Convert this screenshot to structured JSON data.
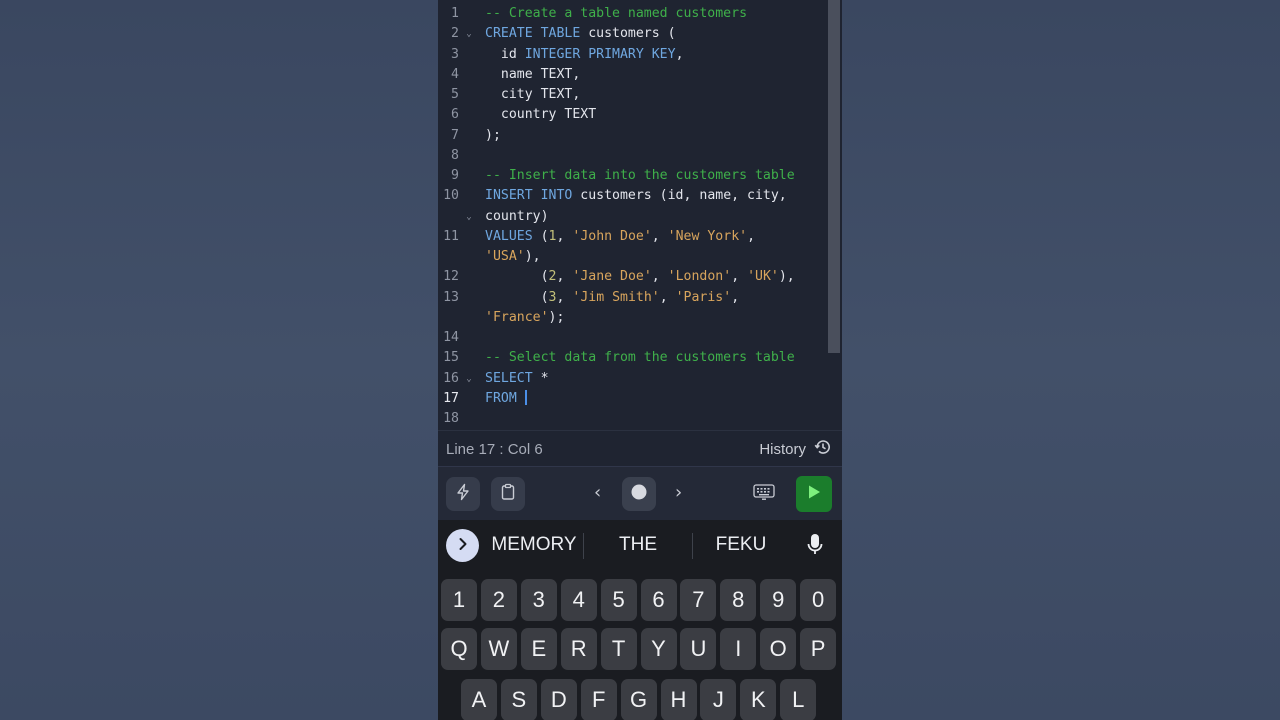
{
  "editor": {
    "lines": [
      {
        "num": "1",
        "fold": "",
        "tokens": [
          {
            "t": "-- Create a table named customers",
            "c": "cm"
          }
        ]
      },
      {
        "num": "2",
        "fold": "⌄",
        "tokens": [
          {
            "t": "CREATE TABLE",
            "c": "kw"
          },
          {
            "t": " customers (",
            "c": "tx"
          }
        ]
      },
      {
        "num": "3",
        "fold": "",
        "tokens": [
          {
            "t": "  id ",
            "c": "tx"
          },
          {
            "t": "INTEGER PRIMARY KEY",
            "c": "kw"
          },
          {
            "t": ",",
            "c": "tx"
          }
        ]
      },
      {
        "num": "4",
        "fold": "",
        "tokens": [
          {
            "t": "  name TEXT,",
            "c": "tx"
          }
        ]
      },
      {
        "num": "5",
        "fold": "",
        "tokens": [
          {
            "t": "  city TEXT,",
            "c": "tx"
          }
        ]
      },
      {
        "num": "6",
        "fold": "",
        "tokens": [
          {
            "t": "  country TEXT",
            "c": "tx"
          }
        ]
      },
      {
        "num": "7",
        "fold": "",
        "tokens": [
          {
            "t": ");",
            "c": "tx"
          }
        ]
      },
      {
        "num": "8",
        "fold": "",
        "tokens": []
      },
      {
        "num": "9",
        "fold": "",
        "tokens": [
          {
            "t": "-- Insert data into the customers table",
            "c": "cm"
          }
        ]
      },
      {
        "num": "10",
        "fold": "",
        "tokens": [
          {
            "t": "INSERT INTO",
            "c": "kw"
          },
          {
            "t": " customers (id, name, city,",
            "c": "tx"
          }
        ]
      },
      {
        "num": "",
        "fold": "⌄",
        "tokens": [
          {
            "t": "country)",
            "c": "tx"
          }
        ]
      },
      {
        "num": "11",
        "fold": "",
        "tokens": [
          {
            "t": "VALUES",
            "c": "kw"
          },
          {
            "t": " (",
            "c": "tx"
          },
          {
            "t": "1",
            "c": "nm"
          },
          {
            "t": ", ",
            "c": "tx"
          },
          {
            "t": "'John Doe'",
            "c": "st"
          },
          {
            "t": ", ",
            "c": "tx"
          },
          {
            "t": "'New York'",
            "c": "st"
          },
          {
            "t": ",",
            "c": "tx"
          }
        ]
      },
      {
        "num": "",
        "fold": "",
        "tokens": [
          {
            "t": "'USA'",
            "c": "st"
          },
          {
            "t": "),",
            "c": "tx"
          }
        ]
      },
      {
        "num": "12",
        "fold": "",
        "tokens": [
          {
            "t": "       (",
            "c": "tx"
          },
          {
            "t": "2",
            "c": "nm"
          },
          {
            "t": ", ",
            "c": "tx"
          },
          {
            "t": "'Jane Doe'",
            "c": "st"
          },
          {
            "t": ", ",
            "c": "tx"
          },
          {
            "t": "'London'",
            "c": "st"
          },
          {
            "t": ", ",
            "c": "tx"
          },
          {
            "t": "'UK'",
            "c": "st"
          },
          {
            "t": "),",
            "c": "tx"
          }
        ]
      },
      {
        "num": "13",
        "fold": "",
        "tokens": [
          {
            "t": "       (",
            "c": "tx"
          },
          {
            "t": "3",
            "c": "nm"
          },
          {
            "t": ", ",
            "c": "tx"
          },
          {
            "t": "'Jim Smith'",
            "c": "st"
          },
          {
            "t": ", ",
            "c": "tx"
          },
          {
            "t": "'Paris'",
            "c": "st"
          },
          {
            "t": ",",
            "c": "tx"
          }
        ]
      },
      {
        "num": "",
        "fold": "",
        "tokens": [
          {
            "t": "'France'",
            "c": "st"
          },
          {
            "t": ");",
            "c": "tx"
          }
        ]
      },
      {
        "num": "14",
        "fold": "",
        "tokens": []
      },
      {
        "num": "15",
        "fold": "",
        "tokens": [
          {
            "t": "-- Select data from the customers table",
            "c": "cm"
          }
        ]
      },
      {
        "num": "16",
        "fold": "⌄",
        "tokens": [
          {
            "t": "SELECT",
            "c": "kw"
          },
          {
            "t": " *",
            "c": "tx"
          }
        ]
      },
      {
        "num": "17",
        "fold": "",
        "active": true,
        "cursor": true,
        "tokens": [
          {
            "t": "FROM ",
            "c": "kw"
          }
        ]
      },
      {
        "num": "18",
        "fold": "",
        "tokens": []
      }
    ]
  },
  "status": {
    "position": "Line 17 : Col 6",
    "history_label": "History"
  },
  "toolbar": {
    "icons": [
      "bolt-icon",
      "clipboard-icon",
      "chevron-left-icon",
      "record-dot-icon",
      "chevron-right-icon",
      "keyboard-icon",
      "play-icon"
    ],
    "run_color": "#1b7d2c"
  },
  "keyboard": {
    "suggestions": [
      "MEMORY",
      "THE",
      "FEKU"
    ],
    "number_row": [
      "1",
      "2",
      "3",
      "4",
      "5",
      "6",
      "7",
      "8",
      "9",
      "0"
    ],
    "row1": [
      "Q",
      "W",
      "E",
      "R",
      "T",
      "Y",
      "U",
      "I",
      "O",
      "P"
    ],
    "row2": [
      "A",
      "S",
      "D",
      "F",
      "G",
      "H",
      "J",
      "K",
      "L"
    ]
  }
}
